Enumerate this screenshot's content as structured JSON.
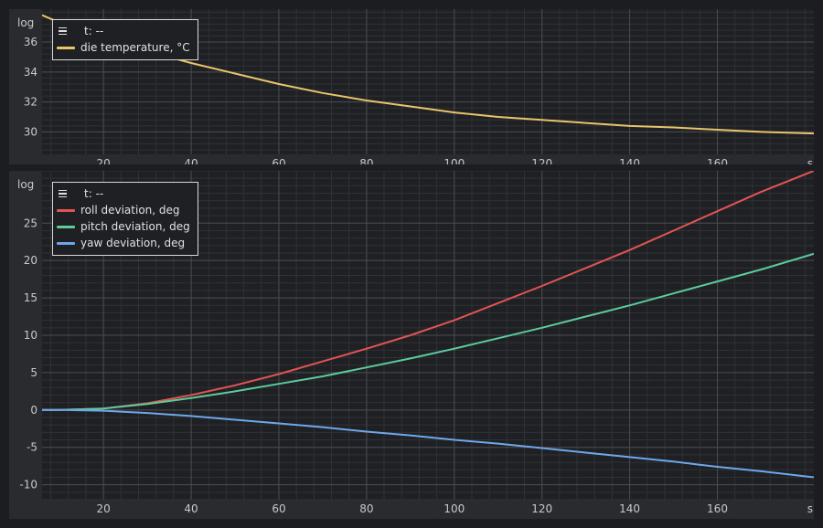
{
  "chart_data": [
    {
      "type": "line",
      "ylabel": "log",
      "xlabel": "s",
      "xlim": [
        6,
        182
      ],
      "ylim": [
        28.5,
        38.2
      ],
      "x_ticks": [
        20,
        40,
        60,
        80,
        100,
        120,
        140,
        160
      ],
      "y_ticks": [
        30,
        32,
        34,
        36
      ],
      "x_tick_labels": [
        "20",
        "40",
        "60",
        "80",
        "100",
        "120",
        "140",
        "160"
      ],
      "y_tick_labels": [
        "30",
        "32",
        "34",
        "36"
      ],
      "grid": true,
      "legend_placement": "top-left",
      "legend_header": "t: --",
      "series": [
        {
          "name": "die temperature, °C",
          "color": "#e8c46a",
          "x": [
            6,
            10,
            20,
            30,
            40,
            50,
            60,
            70,
            80,
            90,
            100,
            110,
            120,
            130,
            140,
            150,
            160,
            170,
            182
          ],
          "values": [
            37.8,
            37.3,
            36.3,
            35.4,
            34.6,
            33.9,
            33.2,
            32.6,
            32.1,
            31.7,
            31.3,
            31.0,
            30.8,
            30.6,
            30.4,
            30.3,
            30.15,
            30.0,
            29.9
          ]
        }
      ]
    },
    {
      "type": "line",
      "ylabel": "log",
      "xlabel": "s",
      "xlim": [
        6,
        182
      ],
      "ylim": [
        -12,
        32
      ],
      "x_ticks": [
        20,
        40,
        60,
        80,
        100,
        120,
        140,
        160
      ],
      "y_ticks": [
        -10,
        -5,
        0,
        5,
        10,
        15,
        20,
        25
      ],
      "x_tick_labels": [
        "20",
        "40",
        "60",
        "80",
        "100",
        "120",
        "140",
        "160"
      ],
      "y_tick_labels": [
        "-10",
        "-5",
        "0",
        "5",
        "10",
        "15",
        "20",
        "25"
      ],
      "grid": true,
      "legend_placement": "top-left",
      "legend_header": "t: --",
      "series": [
        {
          "name": "roll deviation, deg",
          "color": "#e05454",
          "x": [
            6,
            10,
            20,
            30,
            40,
            50,
            60,
            70,
            80,
            90,
            100,
            110,
            120,
            130,
            140,
            150,
            160,
            170,
            182
          ],
          "values": [
            0,
            0,
            0.2,
            0.9,
            2.0,
            3.3,
            4.8,
            6.5,
            8.2,
            10.0,
            12.0,
            14.3,
            16.6,
            19.0,
            21.4,
            24.0,
            26.6,
            29.2,
            32.0
          ]
        },
        {
          "name": "pitch deviation, deg",
          "color": "#5ccc9c",
          "x": [
            6,
            10,
            20,
            30,
            40,
            50,
            60,
            70,
            80,
            90,
            100,
            110,
            120,
            130,
            140,
            150,
            160,
            170,
            182
          ],
          "values": [
            0,
            0,
            0.2,
            0.8,
            1.6,
            2.5,
            3.5,
            4.5,
            5.7,
            6.9,
            8.2,
            9.6,
            11.0,
            12.5,
            14.0,
            15.6,
            17.2,
            18.8,
            20.9
          ]
        },
        {
          "name": "yaw deviation, deg",
          "color": "#6ea8ea",
          "x": [
            6,
            10,
            20,
            30,
            40,
            50,
            60,
            70,
            80,
            90,
            100,
            110,
            120,
            130,
            140,
            150,
            160,
            170,
            182
          ],
          "values": [
            0,
            0,
            -0.1,
            -0.4,
            -0.8,
            -1.3,
            -1.8,
            -2.3,
            -2.9,
            -3.4,
            -4.0,
            -4.5,
            -5.1,
            -5.7,
            -6.3,
            -6.9,
            -7.6,
            -8.2,
            -9.0
          ]
        }
      ]
    }
  ],
  "colors": {
    "window_bg": "#1c1d20",
    "panel_bg": "#2a2b2f",
    "plot_bg": "#1f2024",
    "grid_major": "#4a4b50",
    "grid_minor": "#303136",
    "tick_text": "#c8c8c8"
  }
}
